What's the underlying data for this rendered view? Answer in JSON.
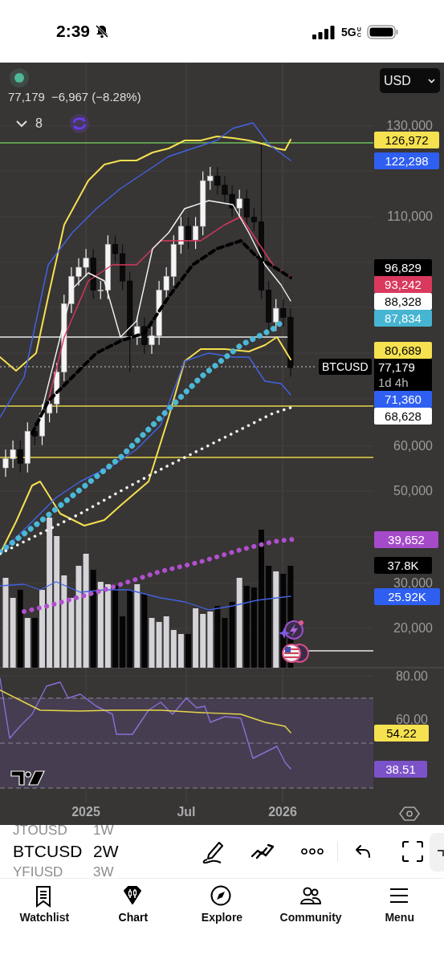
{
  "status_bar": {
    "time": "2:39",
    "network": "5G",
    "network_suffix": "UC"
  },
  "chart": {
    "legend": {
      "price": "77,179",
      "change": "−6,967 (−8.28%)",
      "indicators_count": "8"
    },
    "currency": "USD",
    "symbol_label": "BTCUSD",
    "price_ticks": [
      "130,000",
      "110,000",
      "60,000",
      "50,000",
      "30,000",
      "20,000"
    ],
    "rsi_ticks": [
      "80.00",
      "60.00"
    ],
    "price_tags": [
      {
        "text": "126,972",
        "color": "#f6e150"
      },
      {
        "text": "122,298",
        "color": "#2f5ff0"
      },
      {
        "text": "96,829",
        "color": "#000000"
      },
      {
        "text": "93,242",
        "color": "#d9395d"
      },
      {
        "text": "88,328",
        "color": "#ffffff"
      },
      {
        "text": "87,834",
        "color": "#46b5d1"
      },
      {
        "text": "80,689",
        "color": "#f6e150"
      },
      {
        "text": "77,179",
        "countdown": "1d 4h",
        "color": "#000000"
      },
      {
        "text": "71,360",
        "color": "#2f5ff0"
      },
      {
        "text": "68,628",
        "color": "#ffffff"
      },
      {
        "text": "39,652",
        "color": "#a54bc9"
      },
      {
        "text": "37.8K",
        "color": "#000000"
      },
      {
        "text": "25.92K",
        "color": "#2f5ff0"
      },
      {
        "text": "54.22",
        "color": "#f6e150"
      },
      {
        "text": "38.51",
        "color": "#7c52c9"
      }
    ],
    "time_labels": [
      "2025",
      "Jul",
      "2026"
    ]
  },
  "toolbar": {
    "symbols": [
      {
        "label": "JTOUSD",
        "selected": false
      },
      {
        "label": "BTCUSD",
        "selected": true
      },
      {
        "label": "YFIUSD",
        "selected": false
      }
    ],
    "intervals": [
      {
        "label": "1W",
        "selected": false
      },
      {
        "label": "2W",
        "selected": true
      },
      {
        "label": "3W",
        "selected": false
      }
    ]
  },
  "nav": [
    {
      "label": "Watchlist",
      "selected": false
    },
    {
      "label": "Chart",
      "selected": true
    },
    {
      "label": "Explore",
      "selected": false
    },
    {
      "label": "Community",
      "selected": false
    },
    {
      "label": "Menu",
      "selected": false
    }
  ]
}
